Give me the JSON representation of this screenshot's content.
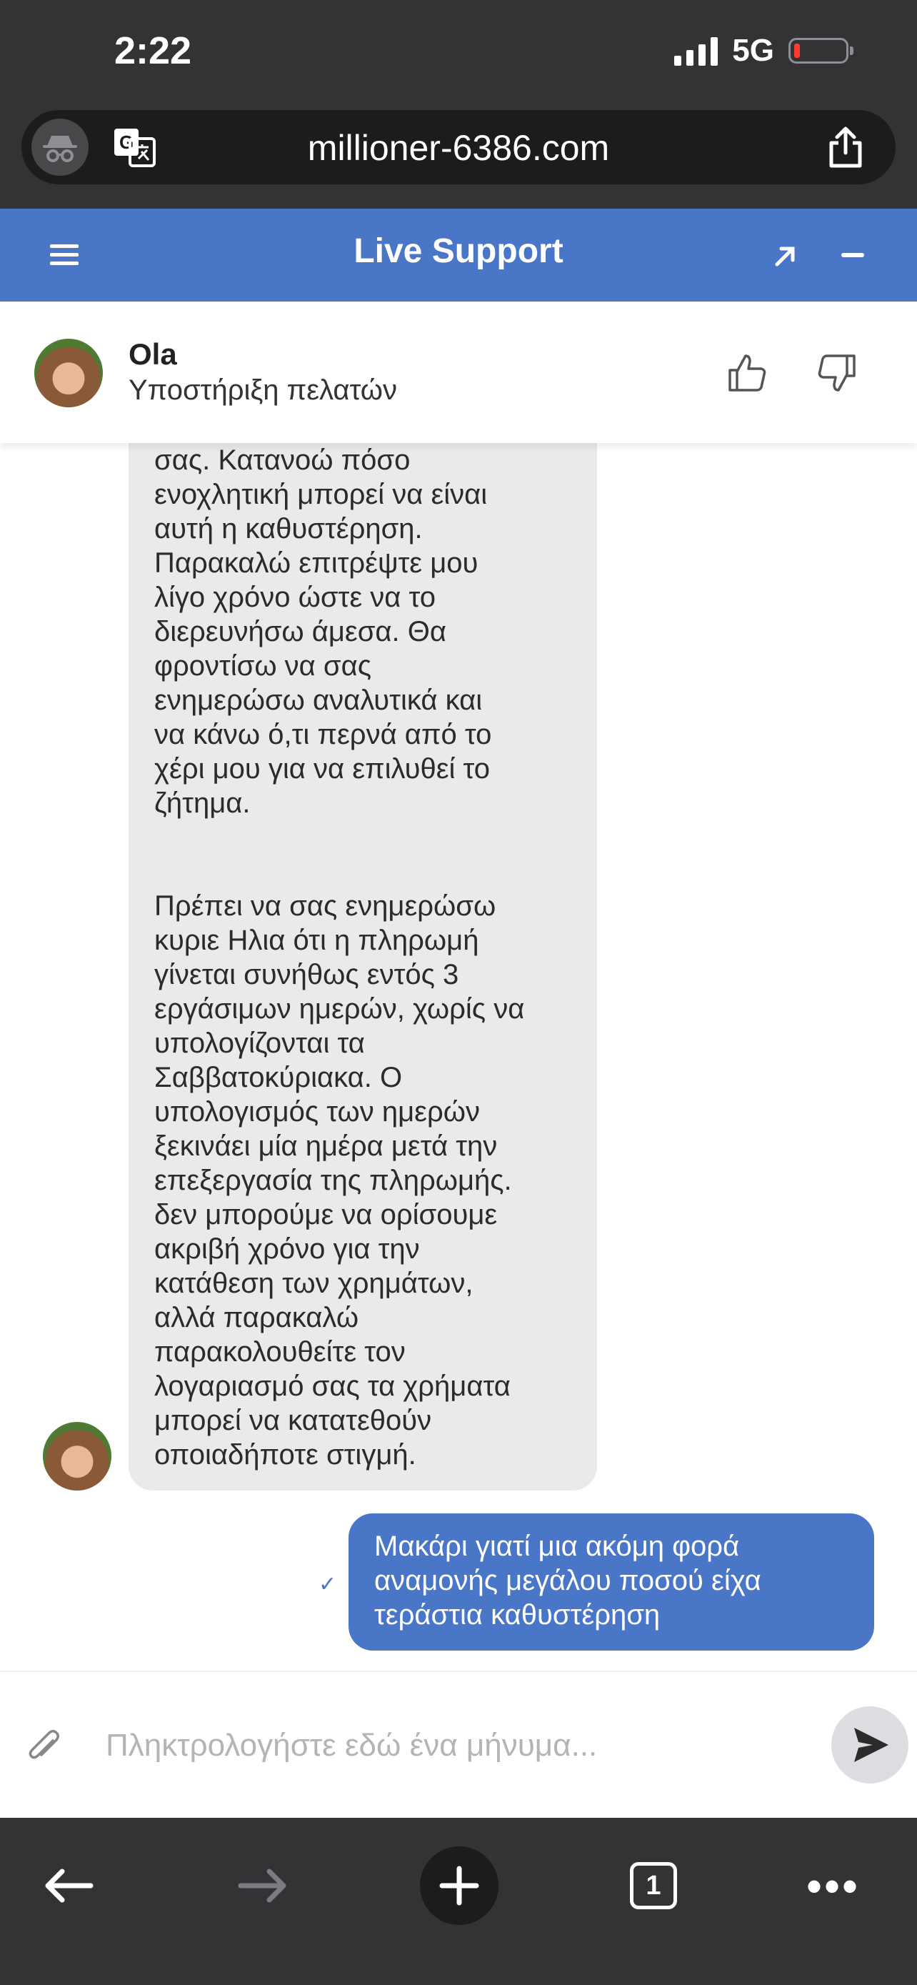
{
  "status_bar": {
    "time": "2:22",
    "network": "5G"
  },
  "browser": {
    "url": "millioner-6386.com"
  },
  "support_header": {
    "title": "Live Support"
  },
  "agent": {
    "name": "Ola",
    "role": "Υποστήριξη πελατών"
  },
  "messages": [
    {
      "from": "agent",
      "text": "προκύψει με την ανάληψή\nσας. Κατανοώ πόσο\nενοχλητική μπορεί να είναι\nαυτή η καθυστέρηση.\nΠαρακαλώ επιτρέψτε μου\nλίγο χρόνο ώστε να το\nδιερευνήσω άμεσα. Θα\nφροντίσω να σας\nενημερώσω αναλυτικά και\nνα κάνω ό,τι περνά από το\nχέρι μου για να επιλυθεί το\nζήτημα."
    },
    {
      "from": "agent",
      "text": "Πρέπει να σας ενημερώσω\nκυριε Ηλια ότι η πληρωμή\nγίνεται συνήθως εντός 3\nεργάσιμων ημερών, χωρίς να\nυπολογίζονται τα\nΣαββατοκύριακα. Ο\nυπολογισμός των ημερών\nξεκινάει μία ημέρα μετά την\nεπεξεργασία της πληρωμής.\nδεν μπορούμε να ορίσουμε\nακριβή χρόνο για την\nκατάθεση των χρημάτων,\nαλλά παρακαλώ\nπαρακολουθείτε τον\nλογαριασμό σας  τα χρήματα\nμπορεί να κατατεθούν\nοποιαδήποτε στιγμή."
    },
    {
      "from": "user",
      "text": "Μακάρι γιατί μια ακόμη φορά\nαναμονής μεγάλου ποσού είχα\nτεράστια καθυστέρηση",
      "status_icon": "check-icon"
    }
  ],
  "composer": {
    "placeholder": "Πληκτρολογήστε εδώ ένα μήνυμα..."
  },
  "toolbar": {
    "tab_count": "1"
  },
  "colors": {
    "brand": "#4a76c8",
    "chrome": "#333335",
    "incoming_bubble": "#e9eaec",
    "battery_low": "#ff3b30"
  }
}
